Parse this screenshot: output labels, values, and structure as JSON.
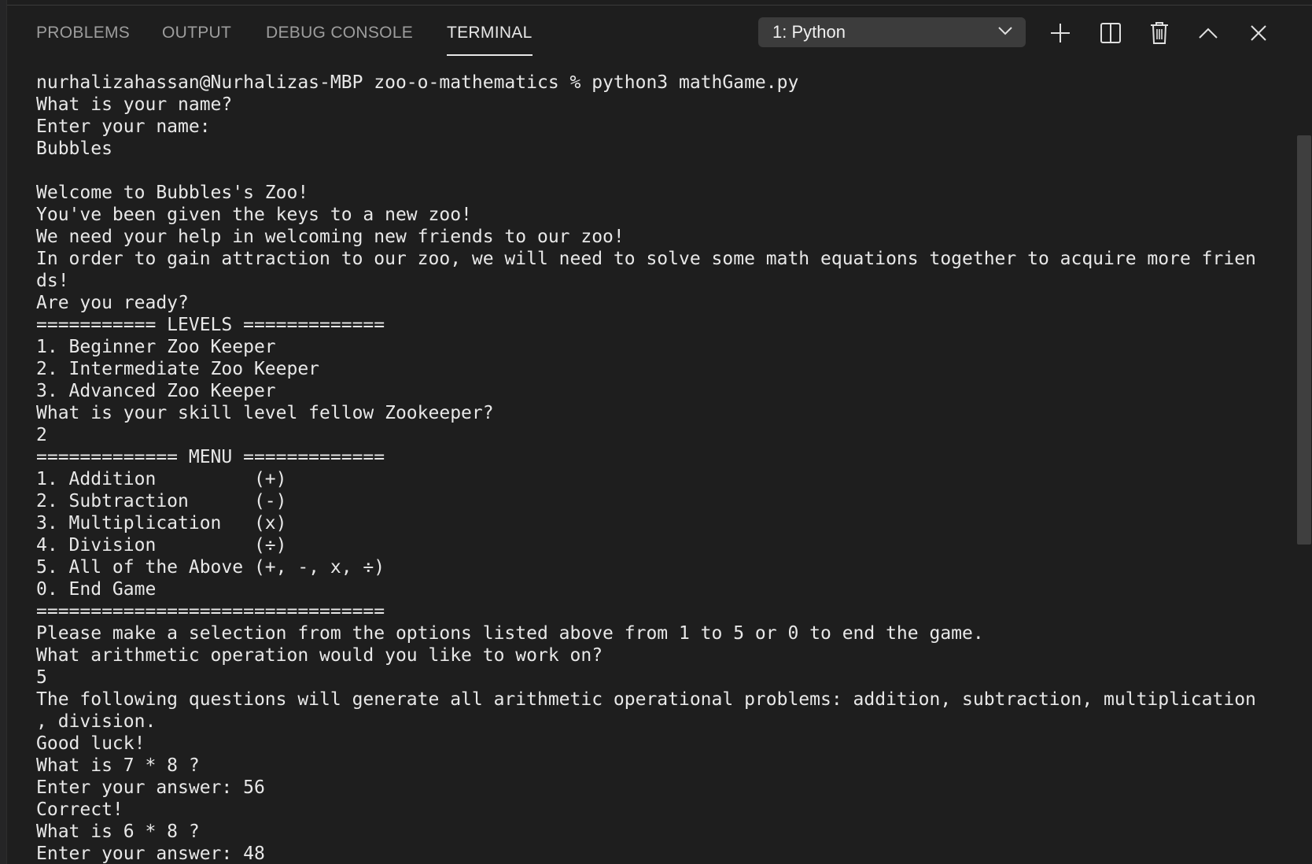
{
  "panel": {
    "tabs": [
      {
        "label": "PROBLEMS"
      },
      {
        "label": "OUTPUT"
      },
      {
        "label": "DEBUG CONSOLE"
      },
      {
        "label": "TERMINAL"
      }
    ],
    "active_tab": "TERMINAL",
    "terminal_select": {
      "value": "1: Python"
    },
    "actions": [
      {
        "icon": "plus-icon"
      },
      {
        "icon": "split-terminal-icon"
      },
      {
        "icon": "trash-icon"
      },
      {
        "icon": "chevron-up-icon"
      },
      {
        "icon": "close-icon"
      }
    ]
  },
  "terminal": {
    "lines": [
      "nurhalizahassan@Nurhalizas-MBP zoo-o-mathematics % python3 mathGame.py",
      "What is your name?",
      "Enter your name:",
      "Bubbles",
      "",
      "Welcome to Bubbles's Zoo!",
      "You've been given the keys to a new zoo!",
      "We need your help in welcoming new friends to our zoo!",
      "In order to gain attraction to our zoo, we will need to solve some math equations together to acquire more frien",
      "ds!",
      "Are you ready?",
      "=========== LEVELS =============",
      "1. Beginner Zoo Keeper",
      "2. Intermediate Zoo Keeper",
      "3. Advanced Zoo Keeper",
      "What is your skill level fellow Zookeeper?",
      "2",
      "============= MENU =============",
      "1. Addition         (+)",
      "2. Subtraction      (-)",
      "3. Multiplication   (x)",
      "4. Division         (÷)",
      "5. All of the Above (+, -, x, ÷)",
      "0. End Game",
      "================================",
      "Please make a selection from the options listed above from 1 to 5 or 0 to end the game.",
      "What arithmetic operation would you like to work on?",
      "5",
      "The following questions will generate all arithmetic operational problems: addition, subtraction, multiplication",
      ", division.",
      "Good luck!",
      "What is 7 * 8 ?",
      "Enter your answer: 56",
      "Correct!",
      "What is 6 * 8 ?",
      "Enter your answer: 48"
    ]
  },
  "colors": {
    "background": "#1e1e1e",
    "tab_inactive": "#9d9d9d",
    "tab_active": "#e7e7e7",
    "terminal_text": "#e8e8e8",
    "select_background": "#3c3c3c"
  }
}
